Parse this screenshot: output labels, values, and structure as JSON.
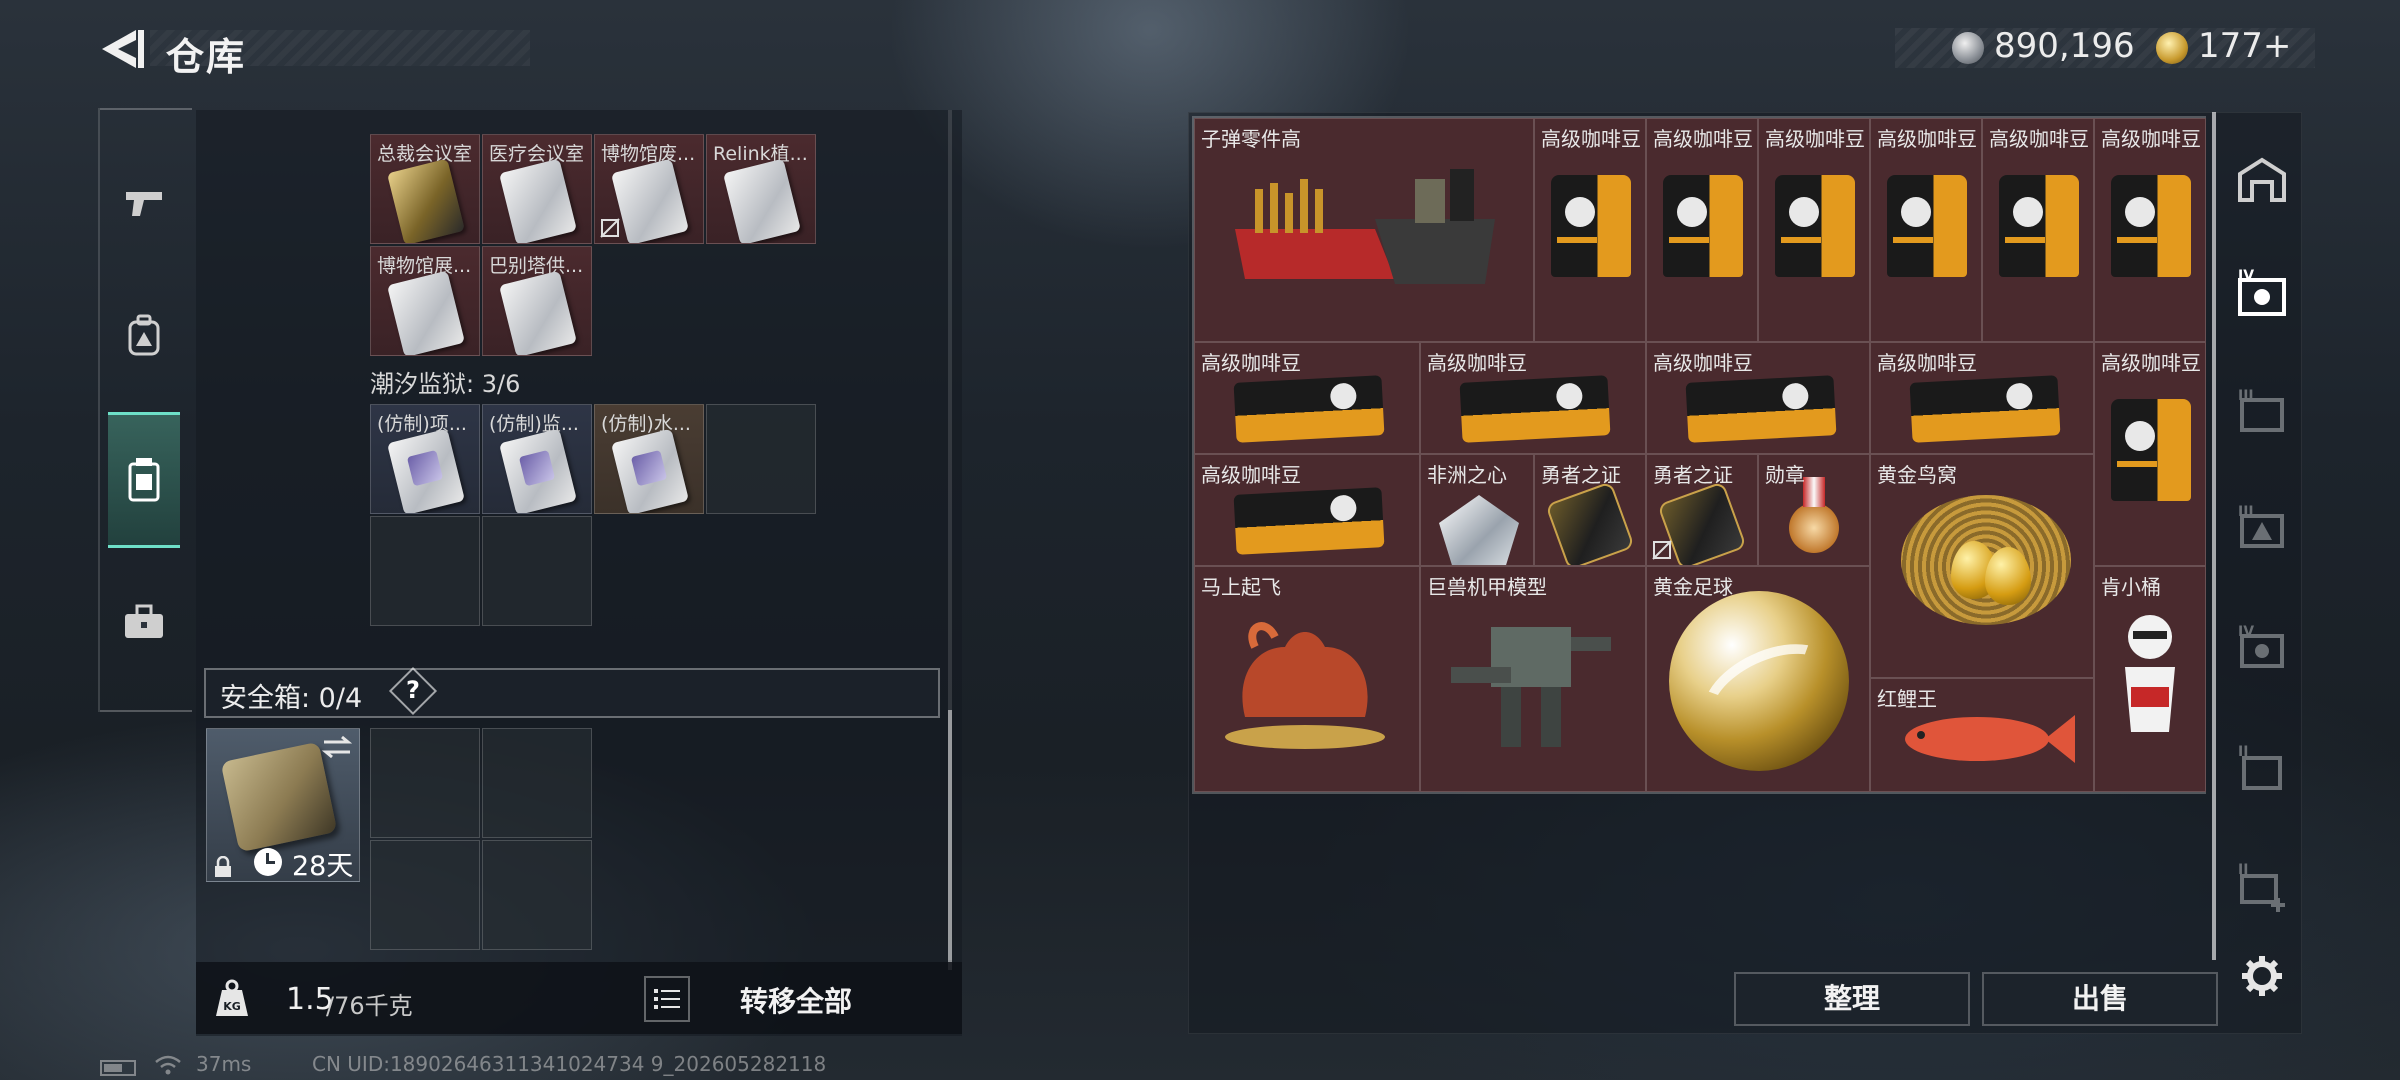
{
  "header": {
    "title": "仓库",
    "currency": {
      "silver": "890,196",
      "gold": "177+"
    }
  },
  "left_nav": {
    "items": [
      {
        "icon": "pistol-icon"
      },
      {
        "icon": "backpack-icon"
      },
      {
        "icon": "container-icon",
        "active": true
      },
      {
        "icon": "briefcase-icon"
      }
    ]
  },
  "storage": {
    "group1": {
      "items": [
        "总裁会议室",
        "医疗会议室",
        "博物馆废...",
        "Relink植...",
        "博物馆展...",
        "巴别塔供..."
      ]
    },
    "group2": {
      "title": "潮汐监狱: 3/6",
      "items": [
        "(仿制)项...",
        "(仿制)监...",
        "(仿制)水..."
      ]
    }
  },
  "safe_box": {
    "label": "安全箱: 0/4",
    "help": "?",
    "days": "28天"
  },
  "weight": {
    "current": "1.5",
    "capacity": "/76千克",
    "transfer_all": "转移全部"
  },
  "right_grid": {
    "items": {
      "ammo_parts": "子弹零件高",
      "coffee": "高级咖啡豆",
      "heart_of_africa": "非洲之心",
      "brave_proof": "勇者之证",
      "medal": "勋章",
      "golden_nest": "黄金鸟窝",
      "horse": "马上起飞",
      "mech_model": "巨兽机甲模型",
      "golden_ball": "黄金足球",
      "kfc_bucket": "肯小桶",
      "red_carp": "红鲤王"
    }
  },
  "actions": {
    "organize": "整理",
    "sell": "出售"
  },
  "status_bar": {
    "ping": "37ms",
    "uid": "CN UID:18902646311341024734 9_202605282118"
  },
  "colors": {
    "accent": "#6ee0c8",
    "item_bg": "#4a2a2e",
    "panel_bg": "#141a21"
  }
}
